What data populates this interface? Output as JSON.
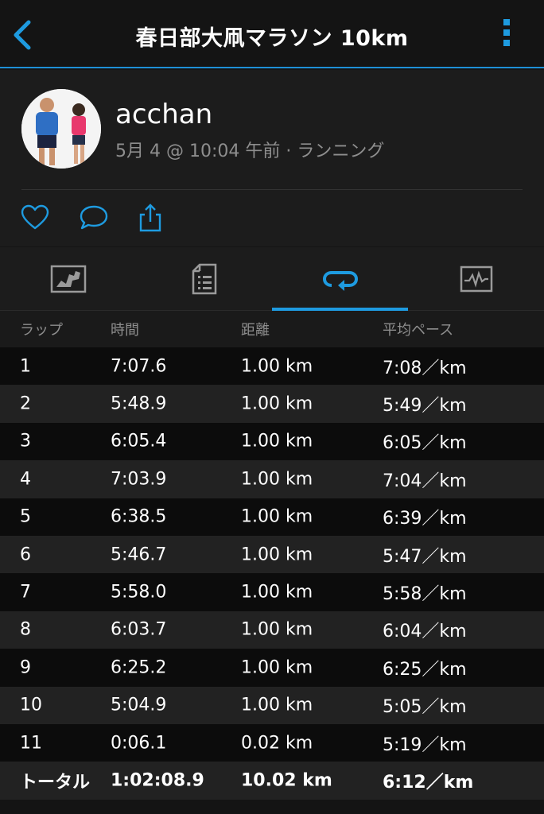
{
  "header": {
    "title": "春日部大凧マラソン 10km",
    "back_icon": "chevron-left-icon",
    "menu_icon": "vertical-dots-icon",
    "accent_color": "#1e9be0"
  },
  "activity": {
    "username": "acchan",
    "meta": "5月 4 @ 10:04 午前 · ランニング",
    "actions": [
      "heart-icon",
      "comment-icon",
      "share-icon"
    ]
  },
  "tabs": [
    {
      "icon": "map-icon",
      "active": false
    },
    {
      "icon": "summary-list-icon",
      "active": false
    },
    {
      "icon": "laps-icon",
      "active": true
    },
    {
      "icon": "chart-icon",
      "active": false
    }
  ],
  "laps": {
    "headers": [
      "ラップ",
      "時間",
      "距離",
      "平均ペース"
    ],
    "rows": [
      [
        "1",
        "7:07.6",
        "1.00 km",
        "7:08／km"
      ],
      [
        "2",
        "5:48.9",
        "1.00 km",
        "5:49／km"
      ],
      [
        "3",
        "6:05.4",
        "1.00 km",
        "6:05／km"
      ],
      [
        "4",
        "7:03.9",
        "1.00 km",
        "7:04／km"
      ],
      [
        "5",
        "6:38.5",
        "1.00 km",
        "6:39／km"
      ],
      [
        "6",
        "5:46.7",
        "1.00 km",
        "5:47／km"
      ],
      [
        "7",
        "5:58.0",
        "1.00 km",
        "5:58／km"
      ],
      [
        "8",
        "6:03.7",
        "1.00 km",
        "6:04／km"
      ],
      [
        "9",
        "6:25.2",
        "1.00 km",
        "6:25／km"
      ],
      [
        "10",
        "5:04.9",
        "1.00 km",
        "5:05／km"
      ],
      [
        "11",
        "0:06.1",
        "0.02 km",
        "5:19／km"
      ]
    ],
    "total": [
      "トータル",
      "1:02:08.9",
      "10.02 km",
      "6:12／km"
    ]
  }
}
